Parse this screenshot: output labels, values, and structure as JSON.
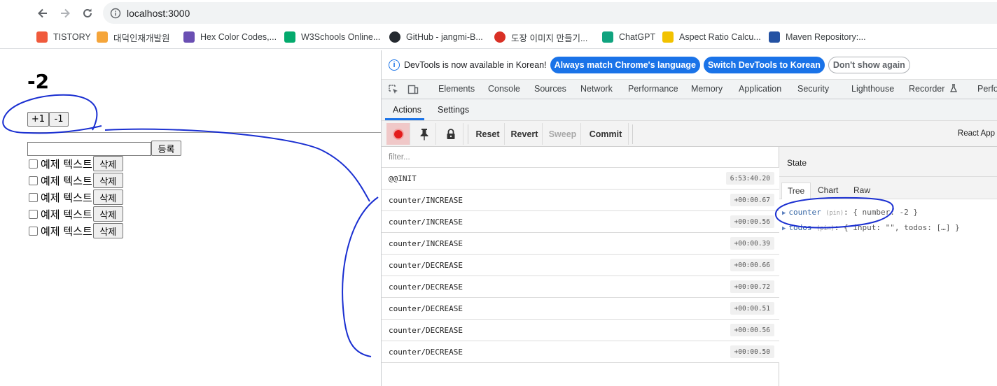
{
  "browser": {
    "url": "localhost:3000",
    "bookmarks": [
      {
        "label": "TISTORY",
        "color": "#f05a3c"
      },
      {
        "label": "대덕인재개발원",
        "color": "#f5a53a"
      },
      {
        "label": "Hex Color Codes,...",
        "color": "#6a4fb3"
      },
      {
        "label": "W3Schools Online...",
        "color": "#04aa6d"
      },
      {
        "label": "GitHub - jangmi-B...",
        "color": "#24292f"
      },
      {
        "label": "도장 이미지 만들기...",
        "color": "#d93025"
      },
      {
        "label": "ChatGPT",
        "color": "#10a37f"
      },
      {
        "label": "Aspect Ratio Calcu...",
        "color": "#f2c200"
      },
      {
        "label": "Maven Repository:...",
        "color": "#2452a3"
      }
    ]
  },
  "app": {
    "counter_value": "-2",
    "plus_label": "+1",
    "minus_label": "-1",
    "register_label": "등록",
    "todos": [
      {
        "text": "예제 텍스트",
        "delete": "삭제"
      },
      {
        "text": "예제 텍스트",
        "delete": "삭제"
      },
      {
        "text": "예제 텍스트",
        "delete": "삭제"
      },
      {
        "text": "예제 텍스트",
        "delete": "삭제"
      },
      {
        "text": "예제 텍스트",
        "delete": "삭제"
      }
    ]
  },
  "devtools": {
    "info_message": "DevTools is now available in Korean!",
    "btn_match": "Always match Chrome's language",
    "btn_switch": "Switch DevTools to Korean",
    "btn_dismiss": "Don't show again",
    "tabs": [
      "Elements",
      "Console",
      "Sources",
      "Network",
      "Performance",
      "Memory",
      "Application",
      "Security",
      "Lighthouse",
      "Recorder",
      "Perfo"
    ],
    "sub_tabs": [
      "Actions",
      "Settings"
    ],
    "toolbar": {
      "reset": "Reset",
      "revert": "Revert",
      "sweep": "Sweep",
      "commit": "Commit",
      "instance": "React App"
    },
    "filter_placeholder": "filter...",
    "actions": [
      {
        "name": "@@INIT",
        "time": "6:53:40.20"
      },
      {
        "name": "counter/INCREASE",
        "time": "+00:00.67"
      },
      {
        "name": "counter/INCREASE",
        "time": "+00:00.56"
      },
      {
        "name": "counter/INCREASE",
        "time": "+00:00.39"
      },
      {
        "name": "counter/DECREASE",
        "time": "+00:00.66"
      },
      {
        "name": "counter/DECREASE",
        "time": "+00:00.72"
      },
      {
        "name": "counter/DECREASE",
        "time": "+00:00.51"
      },
      {
        "name": "counter/DECREASE",
        "time": "+00:00.56"
      },
      {
        "name": "counter/DECREASE",
        "time": "+00:00.50"
      }
    ],
    "state": {
      "title": "State",
      "tabs": [
        "Tree",
        "Chart",
        "Raw"
      ],
      "tree": [
        {
          "key": "counter",
          "pin": "(pin)",
          "value": ": { number: -2 }"
        },
        {
          "key": "todos",
          "pin": "(pin)",
          "value": ": { input: \"\", todos: […] }"
        }
      ]
    }
  },
  "colors": {
    "accent": "#1a73e8",
    "annotation": "#1a2fd1",
    "record": "#e31b1b"
  }
}
